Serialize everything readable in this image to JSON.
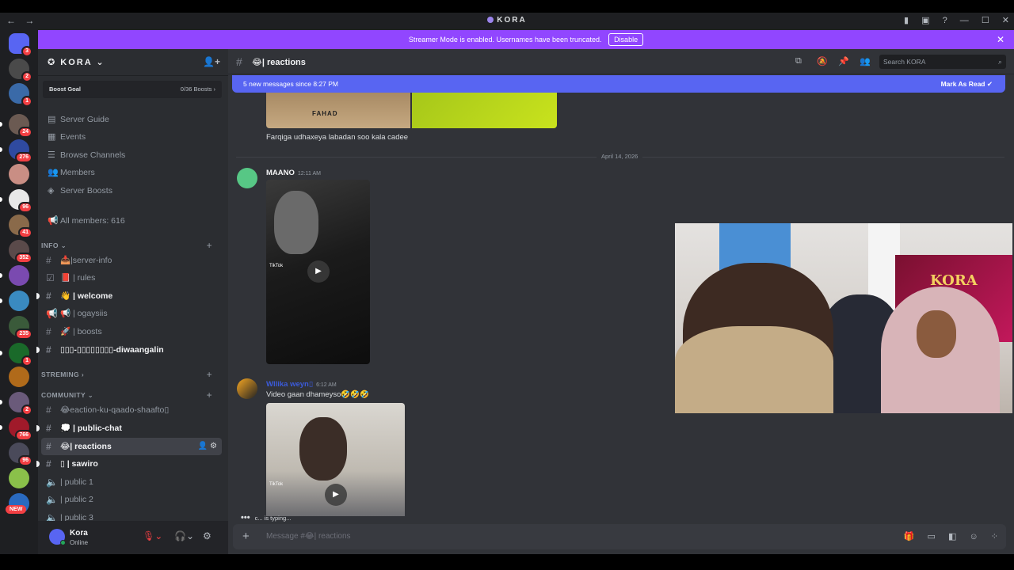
{
  "titlebar": {
    "back": "←",
    "forward": "→",
    "app_name": "KORA"
  },
  "rail": {
    "items": [
      {
        "name": "home",
        "badge": "3",
        "color": "#5865f2"
      },
      {
        "name": "server-1",
        "badge": "2",
        "color": "#4a4a4a"
      },
      {
        "name": "server-2",
        "badge": "1",
        "color": "#3a6aa8"
      },
      {
        "name": "server-3",
        "badge": "24",
        "color": "#6b5a52"
      },
      {
        "name": "server-4",
        "badge": "276",
        "color": "#2f4aa0"
      },
      {
        "name": "server-5",
        "badge": "",
        "color": "#c98e84"
      },
      {
        "name": "server-6",
        "badge": "96",
        "color": "#e8e8e8"
      },
      {
        "name": "server-7",
        "badge": "41",
        "color": "#8a6a4a"
      },
      {
        "name": "server-8",
        "badge": "352",
        "color": "#5a4a4a"
      },
      {
        "name": "server-9",
        "badge": "",
        "color": "#7a4ab0"
      },
      {
        "name": "server-10",
        "badge": "",
        "color": "#3a8ac0"
      },
      {
        "name": "server-11",
        "badge": "235",
        "color": "#3a5a3a"
      },
      {
        "name": "server-12",
        "badge": "1",
        "color": "#1a6a2a"
      },
      {
        "name": "server-13",
        "badge": "",
        "color": "#b06a1a"
      },
      {
        "name": "server-14",
        "badge": "2",
        "color": "#6a5a7a"
      },
      {
        "name": "server-15",
        "badge": "766",
        "color": "#a01a2a"
      },
      {
        "name": "server-16",
        "badge": "96",
        "color": "#4a4a5a"
      },
      {
        "name": "server-17",
        "badge": "",
        "color": "#8ac04a"
      },
      {
        "name": "server-18",
        "badge": "",
        "color": "#2a6ac0"
      }
    ],
    "new_label": "NEW"
  },
  "banner": {
    "text": "Streamer Mode is enabled. Usernames have been truncated.",
    "button": "Disable",
    "close": "✕"
  },
  "server": {
    "name": "KORA",
    "boost_label": "Boost Goal",
    "boost_value": "0/36 Boosts",
    "nav": [
      {
        "label": "Server Guide",
        "icon": "book-icon"
      },
      {
        "label": "Events",
        "icon": "calendar-icon"
      },
      {
        "label": "Browse Channels",
        "icon": "list-icon"
      },
      {
        "label": "Members",
        "icon": "members-icon"
      },
      {
        "label": "Server Boosts",
        "icon": "boost-icon"
      }
    ],
    "all_members": "All members: 616",
    "categories": {
      "info": "INFO",
      "streming": "STREMING",
      "community": "COMMUNITY"
    },
    "channels_info": [
      {
        "label": "📥|server-info",
        "type": "text",
        "unread": false
      },
      {
        "label": "📕 | rules",
        "type": "rules",
        "unread": false
      },
      {
        "label": "👋 | welcome",
        "type": "text",
        "unread": true
      },
      {
        "label": "📢 | ogaysiis",
        "type": "announce",
        "unread": false
      },
      {
        "label": "🚀 | boosts",
        "type": "text",
        "unread": false
      },
      {
        "label": "▯▯▯-▯▯▯▯▯▯▯▯-diwaangalin",
        "type": "text",
        "unread": true
      }
    ],
    "channels_community": [
      {
        "label": "😂eaction-ku-qaado-shaafto▯",
        "type": "text",
        "unread": false
      },
      {
        "label": "💭 | public-chat",
        "type": "text",
        "unread": true
      },
      {
        "label": "😂| reactions",
        "type": "text",
        "unread": false,
        "active": true
      },
      {
        "label": "▯ | sawiro",
        "type": "text",
        "unread": true
      },
      {
        "label": "| public 1",
        "type": "voice",
        "unread": false
      },
      {
        "label": "| public 2",
        "type": "voice",
        "unread": false
      },
      {
        "label": "| public 3",
        "type": "voice",
        "unread": false
      }
    ]
  },
  "user": {
    "name": "Kora",
    "status": "Online"
  },
  "channel": {
    "title": "😂| reactions",
    "search_placeholder": "Search KORA",
    "new_messages": "5 new messages since 8:27 PM",
    "mark_read": "Mark As Read"
  },
  "messages": {
    "prev_text": "Farqiga udhaxeya labadan soo kala cadee",
    "image_watermark": "FAHAD",
    "date_divider": "April 14, 2026",
    "msg1": {
      "author": "MAANO",
      "time": "12:11 AM"
    },
    "msg2": {
      "author": "Wllika weyn▯",
      "time": "6:12 AM",
      "text": "Video gaan dhameyso🤣🤣🤣"
    },
    "tiktok": "TikTok",
    "typing": "c... is typing..."
  },
  "composer": {
    "placeholder": "Message #😂| reactions"
  },
  "cam": {
    "poster_text": "KORA"
  }
}
